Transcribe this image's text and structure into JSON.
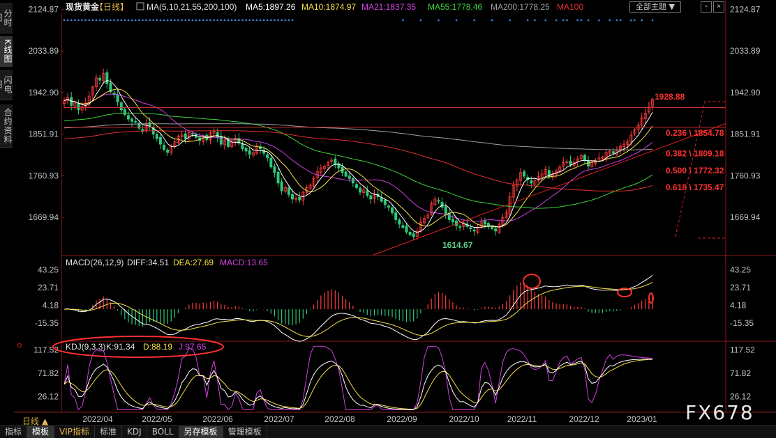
{
  "side_tabs": [
    "分时图",
    "K线图",
    "闪电图",
    "合约资料"
  ],
  "header": {
    "title": "现货黄金",
    "period": "【日线】",
    "ma_label": "MA(5,10,21,55,200,100)",
    "ma5": "MA5:1897.26",
    "ma10": "MA10:1874.97",
    "ma21": "MA21:1837.35",
    "ma55": "MA55:1778.46",
    "ma200": "MA200:1778.25",
    "ma100": "MA100"
  },
  "main_chart_button": "全部主题",
  "window_buttons": [
    "▫",
    "×"
  ],
  "macd": {
    "label": "MACD(26,12,9)",
    "diff": "DIFF:34.51",
    "dea": "DEA:27.69",
    "macd": "MACD:13.65"
  },
  "kdj": {
    "label": "KDJ(9,3,3)",
    "k": "K:91.34",
    "d": "D:88.19",
    "j": "J:97.65"
  },
  "period_label": "日线 ▲",
  "bottom_tabs": [
    "指标",
    "模板",
    "VIP指标",
    "标准",
    "KDJ",
    "BOLL",
    "另存模板",
    "管理模板"
  ],
  "watermark": "FX678",
  "colors": {
    "up": "#ff3b3b",
    "down": "#2ec87a",
    "ma5": "#ffffff",
    "ma10": "#f5e04a",
    "ma21": "#d040e0",
    "ma55": "#3dd23d",
    "ma200": "#a0a0a0",
    "ma100": "#e03030",
    "annotation": "#ff3030"
  },
  "chart_data": [
    {
      "type": "candlestick",
      "title": "现货黄金 日线",
      "x_ticks": [
        "2022/04",
        "2022/05",
        "2022/06",
        "2022/07",
        "2022/08",
        "2022/09",
        "2022/10",
        "2022/11",
        "2022/12",
        "2023/01"
      ],
      "y_ticks": [
        2124.87,
        2033.89,
        1942.9,
        1851.91,
        1760.93,
        1669.94
      ],
      "ylim": [
        1585,
        2130
      ],
      "annotations": {
        "high": 1928.88,
        "low": 1614.67,
        "fib_levels": [
          {
            "label": "0.236 \\ 1854.78",
            "value": 1854.78
          },
          {
            "label": "0.382 \\ 1809.18",
            "value": 1809.18
          },
          {
            "label": "0.500 \\ 1772.32",
            "value": 1772.32
          },
          {
            "label": "0.618 \\ 1735.47",
            "value": 1735.47
          }
        ],
        "resistance_lines": [
          1910,
          1867
        ]
      },
      "closes": [
        1925,
        1932,
        1915,
        1920,
        1905,
        1912,
        1920,
        1935,
        1955,
        1975,
        1970,
        1985,
        1962,
        1945,
        1938,
        1922,
        1905,
        1895,
        1885,
        1880,
        1878,
        1865,
        1858,
        1875,
        1870,
        1852,
        1842,
        1830,
        1818,
        1812,
        1825,
        1835,
        1848,
        1850,
        1842,
        1855,
        1852,
        1845,
        1838,
        1848,
        1840,
        1855,
        1858,
        1845,
        1830,
        1838,
        1825,
        1835,
        1842,
        1832,
        1820,
        1815,
        1808,
        1812,
        1825,
        1820,
        1810,
        1800,
        1780,
        1768,
        1745,
        1728,
        1735,
        1720,
        1710,
        1712,
        1708,
        1725,
        1735,
        1740,
        1755,
        1770,
        1778,
        1782,
        1790,
        1795,
        1785,
        1778,
        1768,
        1760,
        1755,
        1745,
        1735,
        1725,
        1730,
        1718,
        1710,
        1720,
        1715,
        1705,
        1698,
        1692,
        1680,
        1665,
        1655,
        1648,
        1638,
        1632,
        1628,
        1640,
        1660,
        1668,
        1675,
        1700,
        1710,
        1705,
        1692,
        1678,
        1665,
        1660,
        1652,
        1648,
        1658,
        1650,
        1645,
        1640,
        1648,
        1660,
        1655,
        1650,
        1645,
        1640,
        1655,
        1670,
        1680,
        1715,
        1740,
        1752,
        1768,
        1760,
        1752,
        1745,
        1750,
        1760,
        1765,
        1775,
        1758,
        1765,
        1772,
        1780,
        1790,
        1792,
        1785,
        1790,
        1798,
        1805,
        1795,
        1782,
        1790,
        1795,
        1800,
        1802,
        1812,
        1815,
        1810,
        1818,
        1825,
        1830,
        1835,
        1850,
        1862,
        1872,
        1888,
        1898,
        1912,
        1928
      ]
    },
    {
      "type": "line",
      "title": "MACD(26,12,9)",
      "y_ticks": [
        43.25,
        23.71,
        4.18,
        -15.35
      ],
      "ylim": [
        -35,
        55
      ],
      "series": [
        {
          "name": "DIFF",
          "last": 34.51
        },
        {
          "name": "DEA",
          "last": 27.69
        },
        {
          "name": "MACD",
          "last": 13.65
        }
      ]
    },
    {
      "type": "line",
      "title": "KDJ(9,3,3)",
      "y_ticks": [
        117.52,
        71.82,
        26.12
      ],
      "ylim": [
        -5,
        135
      ],
      "series": [
        {
          "name": "K",
          "last": 91.34
        },
        {
          "name": "D",
          "last": 88.19
        },
        {
          "name": "J",
          "last": 97.65
        }
      ]
    }
  ]
}
